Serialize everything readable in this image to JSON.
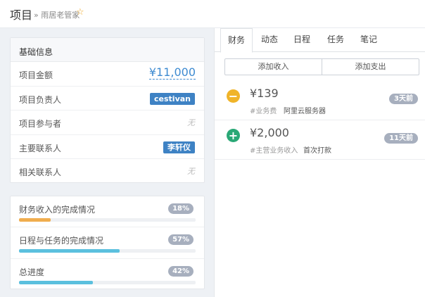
{
  "header": {
    "title": "项目",
    "breadcrumb": "» 雨居老管家",
    "star_icon": "☆"
  },
  "info": {
    "title": "基础信息",
    "rows": [
      {
        "label": "项目金额",
        "value": "¥11,000"
      },
      {
        "label": "项目负责人",
        "value": "cestivan"
      },
      {
        "label": "项目参与者",
        "value": "无"
      },
      {
        "label": "主要联系人",
        "value": "李轩仪"
      },
      {
        "label": "相关联系人",
        "value": "无"
      }
    ]
  },
  "progress": [
    {
      "label": "财务收入的完成情况",
      "pct_text": "18%",
      "value": 18,
      "color": "#f0ad4e"
    },
    {
      "label": "日程与任务的完成情况",
      "pct_text": "57%",
      "value": 57,
      "color": "#5bc0de"
    },
    {
      "label": "总进度",
      "pct_text": "42%",
      "value": 42,
      "color": "#5bc0de"
    }
  ],
  "tabs": [
    {
      "label": "财务",
      "active": true
    },
    {
      "label": "动态",
      "active": false
    },
    {
      "label": "日程",
      "active": false
    },
    {
      "label": "任务",
      "active": false
    },
    {
      "label": "笔记",
      "active": false
    }
  ],
  "buttons": {
    "add_income": "添加收入",
    "add_expense": "添加支出"
  },
  "entries": [
    {
      "icon": "minus-icon",
      "icon_glyph": "−",
      "icon_color": "#f0b429",
      "amount": "¥139",
      "category": "#业务费",
      "note": "阿里云服务器",
      "ago": "3天前"
    },
    {
      "icon": "plus-icon",
      "icon_glyph": "+",
      "icon_color": "#2aa876",
      "amount": "¥2,000",
      "category": "#主营业务收入",
      "note": "首次打款",
      "ago": "11天前"
    }
  ]
}
